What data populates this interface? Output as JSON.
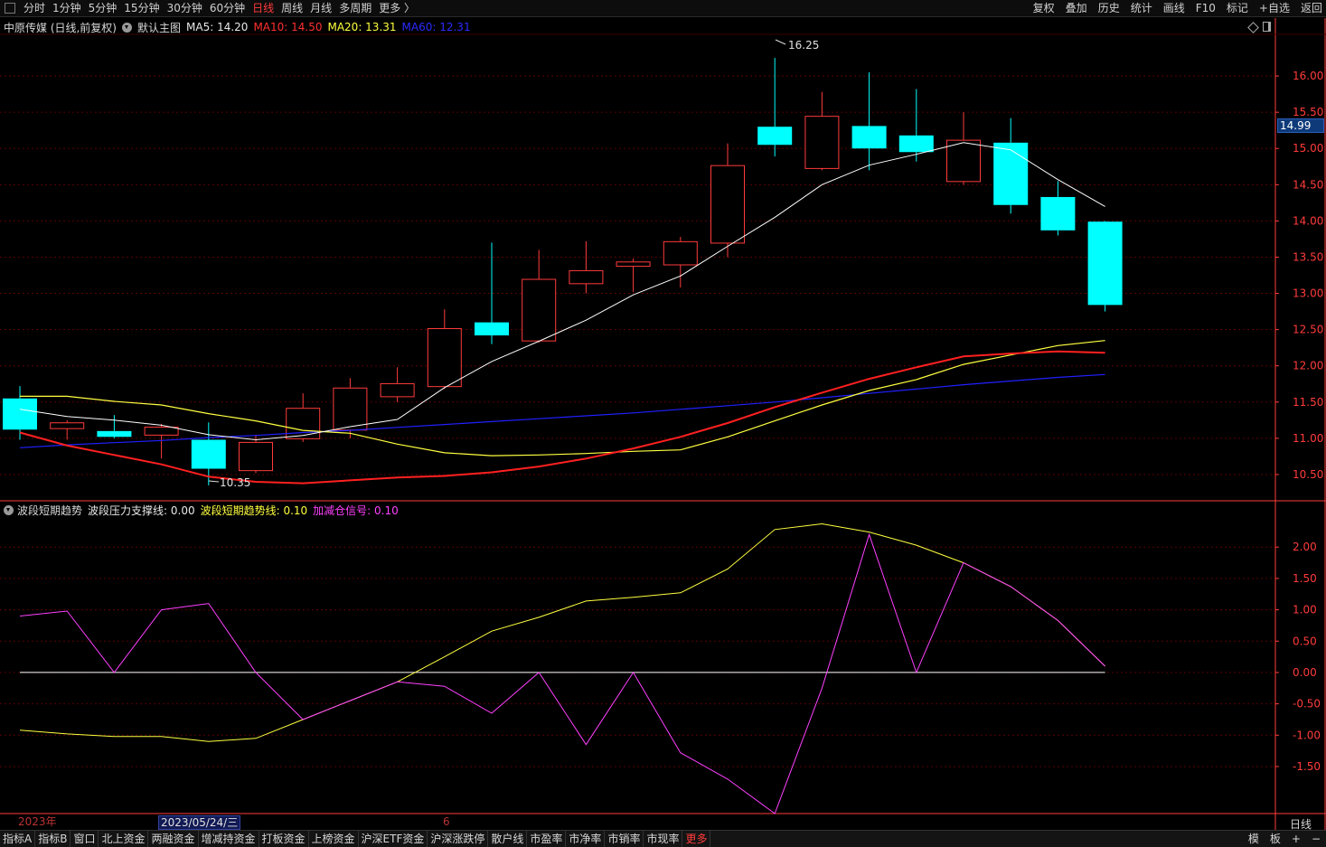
{
  "topbar": {
    "tabs": [
      "分时",
      "1分钟",
      "5分钟",
      "15分钟",
      "30分钟",
      "60分钟",
      "日线",
      "周线",
      "月线",
      "多周期",
      "更多 〉"
    ],
    "active_tab": "日线",
    "right_buttons": [
      "复权",
      "叠加",
      "历史",
      "统计",
      "画线",
      "F10",
      "标记",
      "+自选",
      "返回"
    ]
  },
  "header": {
    "stock": "中原传媒 (日线,前复权)",
    "template": "默认主图",
    "ma5": "MA5: 14.20",
    "ma10": "MA10: 14.50",
    "ma20": "MA20: 13.31",
    "ma60": "MA60: 12.31"
  },
  "indicator": {
    "name": "波段短期趋势",
    "support": "波段压力支撑线: 0.00",
    "trend": "波段短期趋势线: 0.10",
    "signal": "加减仓信号: 0.10"
  },
  "current_price": "14.99",
  "annotations": {
    "high": "16.25",
    "low": "10.35"
  },
  "dates": {
    "year": "2023年",
    "cursor": "2023/05/24/三",
    "month_mark": "6"
  },
  "period": "日线",
  "bottom": {
    "tabs": [
      "指标A",
      "指标B",
      "窗口",
      "北上资金",
      "两融资金",
      "增减持资金",
      "打板资金",
      "上榜资金",
      "沪深ETF资金",
      "沪深涨跌停",
      "散户线",
      "市盈率",
      "市净率",
      "市销率",
      "市现率",
      "更多"
    ],
    "right": [
      "模",
      "板",
      "+",
      "−"
    ]
  },
  "colors": {
    "up": "#ff3b3b",
    "down": "#00ffff",
    "ma5": "#ffffff",
    "ma10": "#ff2020",
    "ma20": "#ffff40",
    "ma60": "#2020ff",
    "support": "#ffffff",
    "trend": "#ffff40",
    "signal": "#ff40ff",
    "axis": "#ff3b3b",
    "grid": "#5a0000"
  },
  "chart_data": [
    {
      "type": "candlestick",
      "y_ticks": [
        16.0,
        15.5,
        15.0,
        14.5,
        14.0,
        13.5,
        13.0,
        12.5,
        12.0,
        11.5,
        11.0,
        10.5
      ],
      "ylim": [
        10.15,
        16.55
      ],
      "candles": [
        {
          "o": 11.55,
          "h": 11.72,
          "l": 10.98,
          "c": 11.12
        },
        {
          "o": 11.14,
          "h": 11.25,
          "l": 10.98,
          "c": 11.22
        },
        {
          "o": 11.1,
          "h": 11.32,
          "l": 11.0,
          "c": 11.02
        },
        {
          "o": 11.05,
          "h": 11.2,
          "l": 10.72,
          "c": 11.16
        },
        {
          "o": 10.98,
          "h": 11.22,
          "l": 10.35,
          "c": 10.58
        },
        {
          "o": 10.56,
          "h": 11.05,
          "l": 10.52,
          "c": 10.95
        },
        {
          "o": 11.0,
          "h": 11.62,
          "l": 10.95,
          "c": 11.42
        },
        {
          "o": 11.12,
          "h": 11.83,
          "l": 11.0,
          "c": 11.7
        },
        {
          "o": 11.58,
          "h": 11.98,
          "l": 11.5,
          "c": 11.76
        },
        {
          "o": 11.72,
          "h": 12.78,
          "l": 11.68,
          "c": 12.52
        },
        {
          "o": 12.6,
          "h": 13.7,
          "l": 12.3,
          "c": 12.42
        },
        {
          "o": 12.35,
          "h": 13.6,
          "l": 12.32,
          "c": 13.2
        },
        {
          "o": 13.14,
          "h": 13.72,
          "l": 13.0,
          "c": 13.32
        },
        {
          "o": 13.38,
          "h": 13.48,
          "l": 13.02,
          "c": 13.44
        },
        {
          "o": 13.4,
          "h": 13.78,
          "l": 13.08,
          "c": 13.72
        },
        {
          "o": 13.7,
          "h": 15.07,
          "l": 13.5,
          "c": 14.77
        },
        {
          "o": 15.3,
          "h": 16.25,
          "l": 14.89,
          "c": 15.05
        },
        {
          "o": 14.73,
          "h": 15.78,
          "l": 14.7,
          "c": 15.45
        },
        {
          "o": 15.31,
          "h": 16.05,
          "l": 14.7,
          "c": 15.0
        },
        {
          "o": 15.18,
          "h": 15.82,
          "l": 14.82,
          "c": 14.95
        },
        {
          "o": 14.55,
          "h": 15.5,
          "l": 14.5,
          "c": 15.12
        },
        {
          "o": 15.08,
          "h": 15.42,
          "l": 14.1,
          "c": 14.22
        },
        {
          "o": 14.33,
          "h": 14.55,
          "l": 13.8,
          "c": 13.87
        },
        {
          "o": 13.99,
          "h": 14.0,
          "l": 12.75,
          "c": 12.84
        }
      ],
      "ma5": [
        11.4,
        11.3,
        11.25,
        11.18,
        11.05,
        10.98,
        11.04,
        11.16,
        11.26,
        11.7,
        12.06,
        12.34,
        12.63,
        12.98,
        13.24,
        13.65,
        14.05,
        14.5,
        14.77,
        14.92,
        15.08,
        14.98,
        14.57,
        14.2
      ],
      "ma10": [
        11.08,
        10.9,
        10.77,
        10.64,
        10.47,
        10.4,
        10.38,
        10.42,
        10.46,
        10.48,
        10.53,
        10.61,
        10.72,
        10.86,
        11.02,
        11.21,
        11.43,
        11.63,
        11.82,
        11.98,
        12.13,
        12.17,
        12.2,
        12.18
      ],
      "ma20": [
        11.58,
        11.58,
        11.51,
        11.46,
        11.34,
        11.24,
        11.11,
        11.07,
        10.92,
        10.8,
        10.76,
        10.77,
        10.79,
        10.82,
        10.84,
        11.02,
        11.24,
        11.46,
        11.66,
        11.81,
        12.02,
        12.15,
        12.28,
        12.35
      ],
      "ma60": [
        10.87,
        10.91,
        10.94,
        10.97,
        11.01,
        11.04,
        11.08,
        11.11,
        11.15,
        11.19,
        11.23,
        11.27,
        11.31,
        11.35,
        11.4,
        11.45,
        11.5,
        11.56,
        11.62,
        11.68,
        11.74,
        11.79,
        11.84,
        11.88
      ]
    },
    {
      "type": "line",
      "y_ticks": [
        2.0,
        1.5,
        1.0,
        0.5,
        0.0,
        -0.5,
        -1.0,
        -1.5
      ],
      "ylim": [
        -2.25,
        2.45
      ],
      "series": [
        {
          "name": "波段压力支撑线",
          "values": [
            0.0,
            0.0,
            0.0,
            0.0,
            0.0,
            0.0,
            0.0,
            0.0,
            0.0,
            0.0,
            0.0,
            0.0,
            0.0,
            0.0,
            0.0,
            0.0,
            0.0,
            0.0,
            0.0,
            0.0,
            0.0,
            0.0,
            0.0,
            0.0
          ]
        },
        {
          "name": "波段短期趋势线",
          "values": [
            -0.92,
            -0.98,
            -1.02,
            -1.02,
            -1.1,
            -1.05,
            -0.75,
            -0.45,
            -0.15,
            0.25,
            0.66,
            0.88,
            1.14,
            1.2,
            1.27,
            1.65,
            2.28,
            2.37,
            2.24,
            2.03,
            1.75,
            1.37,
            0.83,
            0.1
          ]
        },
        {
          "name": "加减仓信号",
          "values": [
            0.9,
            0.98,
            0.0,
            1.0,
            1.1,
            0.0,
            -0.75,
            -0.45,
            -0.15,
            -0.22,
            -0.65,
            0.0,
            -1.15,
            0.0,
            -1.28,
            -1.7,
            -2.25,
            -0.25,
            2.2,
            0.0,
            1.75,
            1.37,
            0.83,
            0.1
          ]
        }
      ]
    }
  ]
}
